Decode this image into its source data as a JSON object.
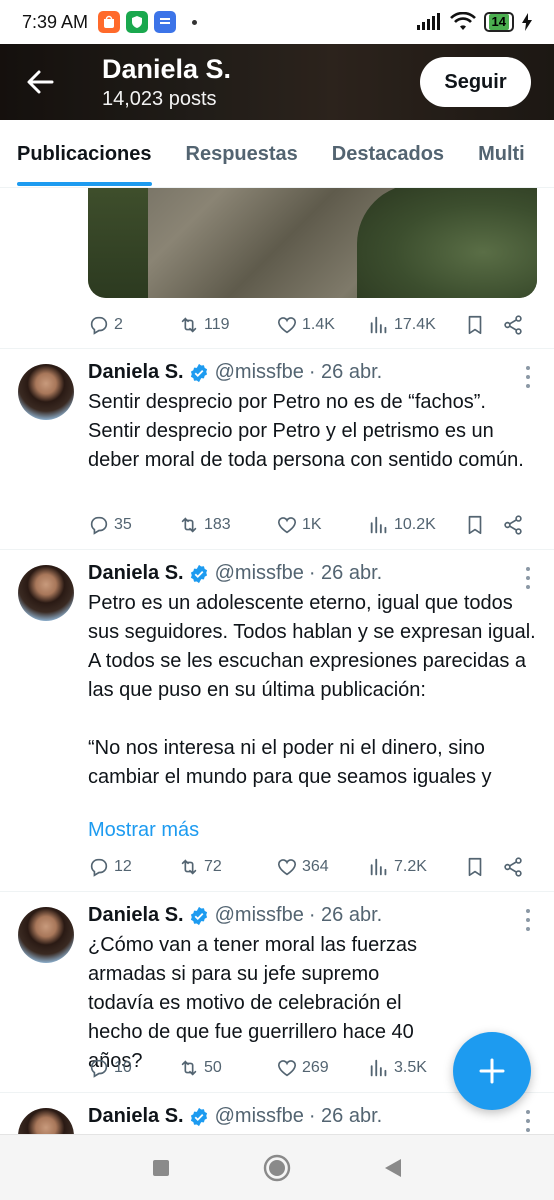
{
  "status_bar": {
    "time": "7:39 AM",
    "battery": "14"
  },
  "header": {
    "name": "Daniela S.",
    "posts": "14,023 posts",
    "follow_label": "Seguir"
  },
  "tabs": [
    {
      "label": "Publicaciones",
      "active": true
    },
    {
      "label": "Respuestas",
      "active": false
    },
    {
      "label": "Destacados",
      "active": false
    },
    {
      "label": "Multi",
      "active": false
    }
  ],
  "top_post": {
    "replies": "2",
    "reposts": "119",
    "likes": "1.4K",
    "views": "17.4K"
  },
  "tweets": [
    {
      "name": "Daniela S.",
      "handle": "@missfbe",
      "date": "· 26 abr.",
      "text": "Sentir desprecio por Petro no es de “fachos”. Sentir desprecio por Petro y el petrismo es un deber moral de toda persona con sentido común.",
      "show_more": "",
      "replies": "35",
      "reposts": "183",
      "likes": "1K",
      "views": "10.2K"
    },
    {
      "name": "Daniela S.",
      "handle": "@missfbe",
      "date": "· 26 abr.",
      "text": "Petro es un adolescente eterno, igual que todos sus seguidores. Todos hablan y se expresan igual. A todos se les escuchan expresiones parecidas a las que puso en su última publicación:\n\n“No nos interesa ni el poder ni el dinero, sino cambiar el mundo para que seamos iguales y",
      "show_more": "Mostrar más",
      "replies": "12",
      "reposts": "72",
      "likes": "364",
      "views": "7.2K"
    },
    {
      "name": "Daniela S.",
      "handle": "@missfbe",
      "date": "· 26 abr.",
      "text": "¿Cómo van a tener moral las fuerzas armadas si para su jefe supremo todavía es motivo de celebración el hecho de que fue guerrillero hace 40 años?",
      "show_more": "",
      "replies": "10",
      "reposts": "50",
      "likes": "269",
      "views": "3.5K"
    },
    {
      "name": "Daniela S.",
      "handle": "@missfbe",
      "date": "· 26 abr.",
      "text": "",
      "show_more": "",
      "replies": "",
      "reposts": "",
      "likes": "",
      "views": ""
    }
  ],
  "colors": {
    "accent": "#1d9bf0",
    "text": "#0f1419",
    "muted": "#536471"
  }
}
